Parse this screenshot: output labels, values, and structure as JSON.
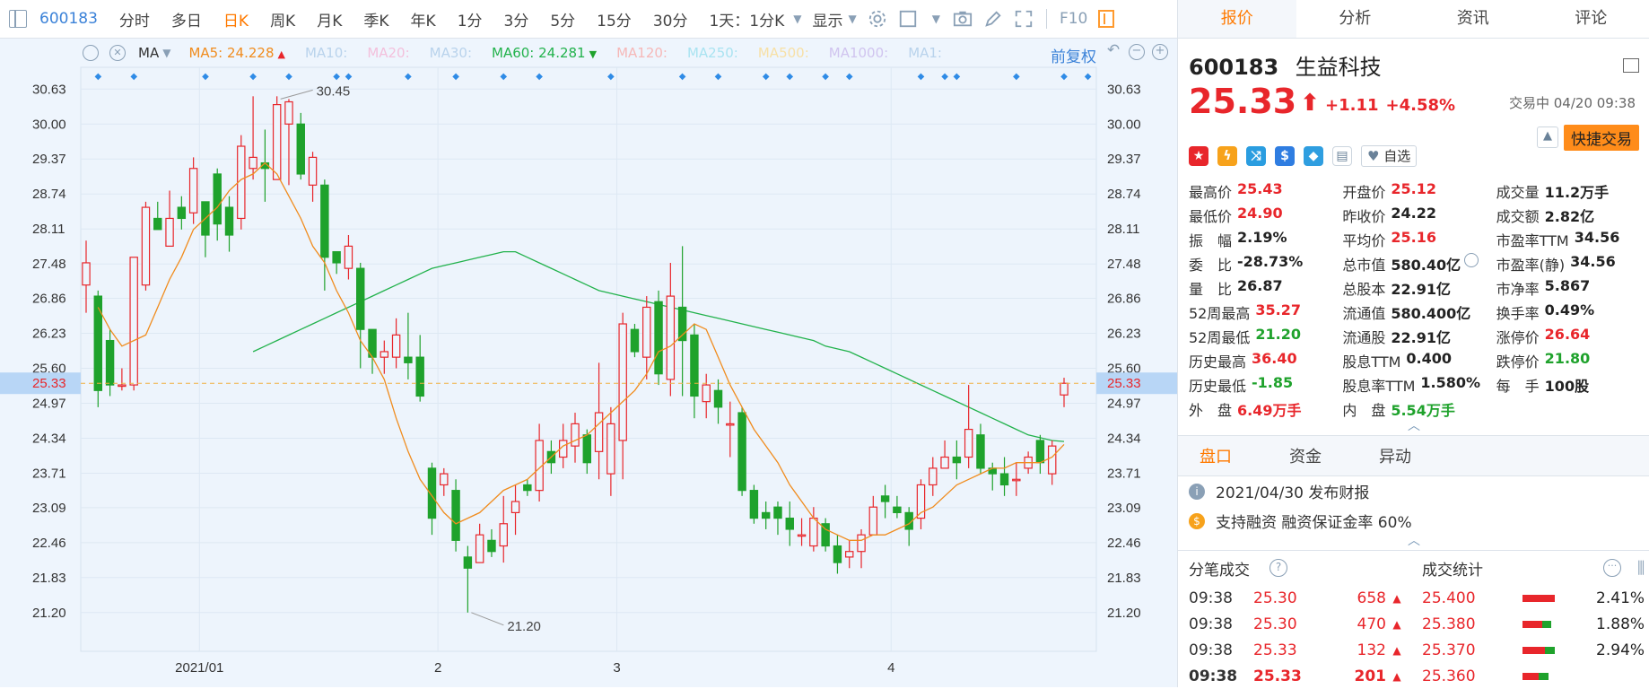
{
  "toolbar": {
    "code": "600183",
    "items": [
      "分时",
      "多日",
      "日K",
      "周K",
      "月K",
      "季K",
      "年K",
      "1分",
      "3分",
      "5分",
      "15分",
      "30分"
    ],
    "active": "日K",
    "dropdown1": "1天：1分K",
    "dropdown2": "显示",
    "f10": "F10"
  },
  "ma_bar": {
    "ma_label": "MA",
    "items": [
      {
        "label": "MA5: 24.228",
        "color": "#f08c1e",
        "arrow": "▲"
      },
      {
        "label": "MA10:",
        "color": "#b9d3ec",
        "arrow": ""
      },
      {
        "label": "MA20:",
        "color": "#f3c0dc",
        "arrow": ""
      },
      {
        "label": "MA30:",
        "color": "#b9d3ec",
        "arrow": ""
      },
      {
        "label": "MA60: 24.281",
        "color": "#22b24c",
        "arrow": "▼"
      },
      {
        "label": "MA120:",
        "color": "#f6b8b8",
        "arrow": ""
      },
      {
        "label": "MA250:",
        "color": "#a9e3f1",
        "arrow": ""
      },
      {
        "label": "MA500:",
        "color": "#f7e0a6",
        "arrow": ""
      },
      {
        "label": "MA1000:",
        "color": "#d0c4ef",
        "arrow": ""
      },
      {
        "label": "MA1:",
        "color": "#b9d3ec",
        "arrow": ""
      }
    ],
    "restore": "前复权"
  },
  "chart_data": {
    "type": "candlestick",
    "y_ticks": [
      "30.63",
      "30.00",
      "29.37",
      "28.74",
      "28.11",
      "27.48",
      "26.86",
      "26.23",
      "25.60",
      "24.97",
      "24.34",
      "23.71",
      "23.09",
      "22.46",
      "21.83",
      "21.20"
    ],
    "ylim": [
      20.55,
      30.99
    ],
    "x_labels": [
      {
        "label": "2021/01",
        "index": 9
      },
      {
        "label": "2",
        "index": 29
      },
      {
        "label": "3",
        "index": 44
      },
      {
        "label": "4",
        "index": 67
      }
    ],
    "current_price": "25.33",
    "max_label": "30.45",
    "min_label": "21.20",
    "max_index": 16,
    "min_index": 32,
    "candles": [
      [
        27.1,
        27.5,
        26.6,
        27.9
      ],
      [
        26.9,
        25.2,
        24.9,
        27.0
      ],
      [
        26.1,
        25.3,
        25.1,
        26.3
      ],
      [
        25.3,
        25.3,
        25.2,
        25.6
      ],
      [
        25.3,
        27.6,
        25.2,
        27.6
      ],
      [
        27.1,
        28.5,
        27.0,
        28.6
      ],
      [
        28.3,
        28.1,
        28.1,
        28.6
      ],
      [
        27.8,
        28.3,
        27.8,
        28.8
      ],
      [
        28.5,
        28.3,
        28.1,
        28.7
      ],
      [
        28.4,
        29.2,
        28.2,
        29.4
      ],
      [
        28.6,
        28.0,
        27.6,
        28.6
      ],
      [
        29.1,
        28.2,
        27.9,
        29.2
      ],
      [
        28.5,
        28.0,
        27.7,
        28.7
      ],
      [
        28.3,
        29.6,
        28.1,
        29.8
      ],
      [
        29.2,
        29.4,
        29.0,
        30.5
      ],
      [
        29.3,
        29.2,
        28.6,
        29.9
      ],
      [
        29.0,
        30.35,
        29.0,
        30.5
      ],
      [
        30.0,
        30.4,
        28.9,
        30.45
      ],
      [
        30.0,
        29.1,
        29.0,
        30.2
      ],
      [
        28.9,
        29.4,
        28.6,
        29.5
      ],
      [
        28.9,
        27.6,
        27.0,
        29.0
      ],
      [
        27.7,
        27.5,
        27.3,
        27.7
      ],
      [
        27.4,
        27.8,
        27.2,
        28.0
      ],
      [
        27.4,
        26.3,
        25.6,
        27.5
      ],
      [
        26.3,
        25.8,
        25.5,
        26.3
      ],
      [
        25.8,
        25.9,
        25.5,
        26.1
      ],
      [
        25.8,
        26.2,
        25.6,
        26.5
      ],
      [
        25.8,
        25.7,
        25.4,
        26.6
      ],
      [
        25.8,
        25.1,
        25.0,
        26.2
      ],
      [
        23.8,
        22.9,
        22.6,
        23.9
      ],
      [
        23.5,
        23.7,
        23.3,
        23.8
      ],
      [
        23.4,
        22.5,
        22.3,
        23.6
      ],
      [
        22.2,
        22.0,
        21.2,
        22.4
      ],
      [
        22.1,
        22.6,
        22.1,
        22.8
      ],
      [
        22.5,
        22.3,
        22.2,
        22.7
      ],
      [
        22.4,
        22.8,
        22.1,
        23.3
      ],
      [
        23.0,
        23.2,
        22.6,
        23.5
      ],
      [
        23.5,
        23.4,
        23.3,
        23.6
      ],
      [
        23.4,
        24.3,
        23.2,
        24.6
      ],
      [
        24.1,
        23.9,
        23.7,
        24.3
      ],
      [
        24.0,
        24.3,
        23.8,
        24.6
      ],
      [
        24.2,
        24.6,
        23.9,
        24.8
      ],
      [
        24.4,
        23.9,
        23.7,
        24.5
      ],
      [
        24.1,
        24.8,
        23.6,
        25.7
      ],
      [
        23.7,
        24.6,
        23.3,
        24.9
      ],
      [
        24.3,
        26.4,
        23.6,
        26.6
      ],
      [
        26.3,
        25.9,
        25.8,
        26.4
      ],
      [
        25.8,
        26.7,
        25.4,
        26.9
      ],
      [
        26.8,
        25.5,
        25.3,
        27.0
      ],
      [
        25.4,
        26.9,
        25.1,
        27.5
      ],
      [
        26.7,
        26.1,
        25.1,
        27.8
      ],
      [
        26.2,
        25.1,
        24.7,
        26.4
      ],
      [
        25.0,
        25.3,
        24.7,
        25.5
      ],
      [
        25.2,
        24.9,
        24.6,
        25.4
      ],
      [
        24.6,
        24.6,
        24.0,
        25.0
      ],
      [
        24.8,
        23.4,
        23.3,
        24.9
      ],
      [
        23.4,
        22.9,
        22.8,
        23.5
      ],
      [
        23.0,
        22.9,
        22.7,
        23.2
      ],
      [
        23.1,
        22.9,
        22.6,
        23.2
      ],
      [
        22.9,
        22.7,
        22.4,
        23.2
      ],
      [
        22.6,
        22.6,
        22.4,
        22.9
      ],
      [
        22.4,
        22.9,
        22.3,
        23.1
      ],
      [
        22.8,
        22.4,
        22.3,
        22.9
      ],
      [
        22.4,
        22.1,
        21.9,
        22.6
      ],
      [
        22.2,
        22.3,
        22.0,
        22.5
      ],
      [
        22.3,
        22.6,
        22.0,
        22.7
      ],
      [
        22.6,
        23.1,
        22.6,
        23.3
      ],
      [
        23.3,
        23.2,
        22.9,
        23.5
      ],
      [
        23.1,
        23.0,
        22.9,
        23.3
      ],
      [
        23.0,
        22.7,
        22.4,
        23.1
      ],
      [
        22.9,
        23.5,
        22.7,
        23.6
      ],
      [
        23.5,
        23.8,
        23.3,
        24.0
      ],
      [
        23.8,
        24.0,
        23.8,
        24.3
      ],
      [
        24.0,
        23.9,
        23.6,
        24.3
      ],
      [
        24.0,
        24.5,
        23.8,
        25.3
      ],
      [
        24.4,
        23.8,
        23.7,
        24.6
      ],
      [
        23.8,
        23.7,
        23.4,
        23.9
      ],
      [
        23.7,
        23.5,
        23.3,
        24.0
      ],
      [
        23.6,
        23.6,
        23.3,
        23.9
      ],
      [
        23.8,
        24.0,
        23.7,
        24.1
      ],
      [
        24.3,
        23.9,
        23.7,
        24.4
      ],
      [
        23.7,
        24.2,
        23.5,
        24.3
      ],
      [
        25.12,
        25.33,
        24.9,
        25.43
      ]
    ],
    "ma5": [
      26.7,
      26.3,
      26.0,
      26.1,
      26.2,
      26.7,
      27.2,
      27.6,
      28.1,
      28.3,
      28.5,
      28.8,
      29.0,
      29.1,
      29.3,
      29.1,
      28.7,
      28.3,
      27.8,
      27.5,
      27.0,
      26.6,
      26.1,
      25.8,
      25.4,
      24.7,
      24.1,
      23.6,
      23.3,
      23.0,
      22.8,
      22.9,
      23.0,
      23.2,
      23.4,
      23.5,
      23.6,
      23.8,
      24.0,
      24.2,
      24.3,
      24.4,
      24.6,
      24.8,
      25.0,
      25.2,
      25.5,
      25.9,
      26.0,
      26.2,
      26.4,
      26.3,
      25.8,
      25.3,
      24.9,
      24.5,
      24.2,
      23.9,
      23.5,
      23.2,
      22.9,
      22.7,
      22.6,
      22.5,
      22.5,
      22.6,
      22.6,
      22.7,
      22.8,
      23.0,
      23.1,
      23.3,
      23.5,
      23.6,
      23.7,
      23.8,
      23.8,
      23.9,
      23.9,
      23.9,
      24.0,
      24.228
    ],
    "ma60": [
      25.9,
      26.0,
      26.1,
      26.2,
      26.3,
      26.4,
      26.5,
      26.6,
      26.7,
      26.8,
      26.9,
      27.0,
      27.1,
      27.2,
      27.3,
      27.4,
      27.45,
      27.5,
      27.55,
      27.6,
      27.65,
      27.7,
      27.7,
      27.6,
      27.5,
      27.4,
      27.3,
      27.2,
      27.1,
      27.0,
      26.95,
      26.9,
      26.85,
      26.8,
      26.75,
      26.7,
      26.65,
      26.6,
      26.55,
      26.5,
      26.45,
      26.4,
      26.35,
      26.3,
      26.25,
      26.2,
      26.15,
      26.1,
      26.0,
      25.95,
      25.9,
      25.8,
      25.7,
      25.6,
      25.5,
      25.4,
      25.3,
      25.2,
      25.1,
      25.0,
      24.9,
      24.8,
      24.7,
      24.6,
      24.5,
      24.4,
      24.35,
      24.3,
      24.281
    ],
    "markers": [
      1,
      4,
      10,
      14,
      17,
      21,
      22,
      27,
      31,
      35,
      38,
      44,
      50,
      53,
      57,
      59,
      62,
      64,
      70,
      72,
      73,
      78,
      82,
      84
    ]
  },
  "panel": {
    "tabs": [
      "报价",
      "分析",
      "资讯",
      "评论"
    ],
    "active_tab": "报价",
    "code": "600183",
    "name": "生益科技",
    "price": "25.33",
    "arrow": "⬆",
    "change": "+1.11",
    "change_pct": "+4.58%",
    "trade_status": "交易中 04/20 09:38",
    "favorite": "自选",
    "quick_trade": "快捷交易",
    "stats": [
      [
        {
          "label": "最高价",
          "value": "25.43",
          "cls": "up"
        },
        {
          "label": "开盘价",
          "value": "25.12",
          "cls": "up"
        },
        {
          "label": "成交量",
          "value": "11.2万手",
          "cls": "blk"
        }
      ],
      [
        {
          "label": "最低价",
          "value": "24.90",
          "cls": "up"
        },
        {
          "label": "昨收价",
          "value": "24.22",
          "cls": "blk"
        },
        {
          "label": "成交额",
          "value": "2.82亿",
          "cls": "blk"
        }
      ],
      [
        {
          "label": "振　幅",
          "value": "2.19%",
          "cls": "blk"
        },
        {
          "label": "平均价",
          "value": "25.16",
          "cls": "up"
        },
        {
          "label": "市盈率TTM",
          "value": "34.56",
          "cls": "blk"
        }
      ],
      [
        {
          "label": "委　比",
          "value": "-28.73%",
          "cls": "blk"
        },
        {
          "label": "总市值",
          "value": "580.40亿",
          "cls": "blk"
        },
        {
          "label": "市盈率(静)",
          "value": "34.56",
          "cls": "blk"
        }
      ],
      [
        {
          "label": "量　比",
          "value": "26.87",
          "cls": "blk"
        },
        {
          "label": "总股本",
          "value": "22.91亿",
          "cls": "blk"
        },
        {
          "label": "市净率",
          "value": "5.867",
          "cls": "blk"
        }
      ],
      [
        {
          "label": "52周最高",
          "value": "35.27",
          "cls": "up"
        },
        {
          "label": "流通值",
          "value": "580.400亿",
          "cls": "blk"
        },
        {
          "label": "换手率",
          "value": "0.49%",
          "cls": "blk"
        }
      ],
      [
        {
          "label": "52周最低",
          "value": "21.20",
          "cls": "dn"
        },
        {
          "label": "流通股",
          "value": "22.91亿",
          "cls": "blk"
        },
        {
          "label": "涨停价",
          "value": "26.64",
          "cls": "up"
        }
      ],
      [
        {
          "label": "历史最高",
          "value": "36.40",
          "cls": "up"
        },
        {
          "label": "股息TTM",
          "value": "0.400",
          "cls": "blk"
        },
        {
          "label": "跌停价",
          "value": "21.80",
          "cls": "dn"
        }
      ],
      [
        {
          "label": "历史最低",
          "value": "-1.85",
          "cls": "dn"
        },
        {
          "label": "股息率TTM",
          "value": "1.580%",
          "cls": "blk"
        },
        {
          "label": "每　手",
          "value": "100股",
          "cls": "blk"
        }
      ],
      [
        {
          "label": "外　盘",
          "value": "6.49万手",
          "cls": "up"
        },
        {
          "label": "内　盘",
          "value": "5.54万手",
          "cls": "dn"
        },
        {
          "label": "",
          "value": "",
          "cls": "blk"
        }
      ]
    ],
    "sub_tabs": [
      "盘口",
      "资金",
      "异动"
    ],
    "active_sub": "盘口",
    "notice1": "2021/04/30 发布财报",
    "notice2": "支持融资 融资保证金率 60%",
    "ticks_title": "分笔成交",
    "stats_title": "成交统计",
    "ticks": [
      {
        "t": "09:38",
        "p": "25.30",
        "v": "658"
      },
      {
        "t": "09:38",
        "p": "25.30",
        "v": "470"
      },
      {
        "t": "09:38",
        "p": "25.33",
        "v": "132"
      },
      {
        "t": "09:38",
        "p": "25.33",
        "v": "201"
      }
    ],
    "trade_stats": [
      {
        "p": "25.400",
        "pct": "2.41%",
        "red": 1.0,
        "green": 0
      },
      {
        "p": "25.380",
        "pct": "1.88%",
        "red": 0.6,
        "green": 0.3
      },
      {
        "p": "25.370",
        "pct": "2.94%",
        "red": 0.7,
        "green": 0.3
      },
      {
        "p": "25.360",
        "pct": "",
        "red": 0.5,
        "green": 0.3
      }
    ]
  }
}
